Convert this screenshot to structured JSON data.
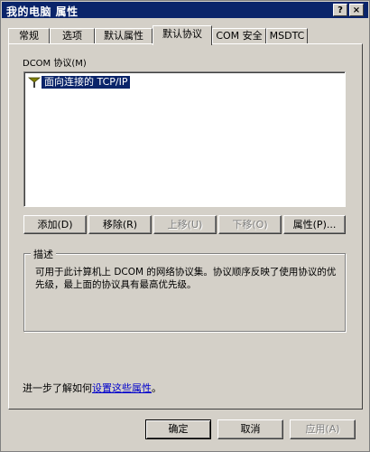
{
  "window": {
    "title": "我的电脑 属性"
  },
  "titlebar": {
    "help_label": "?",
    "close_label": "×"
  },
  "tabs": [
    {
      "label": "常规"
    },
    {
      "label": "选项"
    },
    {
      "label": "默认属性"
    },
    {
      "label": "默认协议"
    },
    {
      "label": "COM 安全"
    },
    {
      "label": "MSDTC"
    }
  ],
  "active_tab": "默认协议",
  "protocols": {
    "label": "DCOM 协议(M)",
    "items": [
      {
        "label": "面向连接的 TCP/IP",
        "selected": true
      }
    ]
  },
  "buttons": {
    "add": "添加(D)",
    "remove": "移除(R)",
    "move_up": "上移(U)",
    "move_down": "下移(O)",
    "properties": "属性(P)..."
  },
  "description": {
    "title": "描述",
    "text": "可用于此计算机上 DCOM 的网络协议集。协议顺序反映了使用协议的优先级，最上面的协议具有最高优先级。"
  },
  "more_info": {
    "prefix": "进一步了解如何",
    "link": "设置这些属性",
    "suffix": "。"
  },
  "dialog": {
    "ok": "确定",
    "cancel": "取消",
    "apply": "应用(A)"
  },
  "colors": {
    "selection": "#0a246a",
    "face": "#d4d0c8",
    "link": "#0000cc"
  }
}
